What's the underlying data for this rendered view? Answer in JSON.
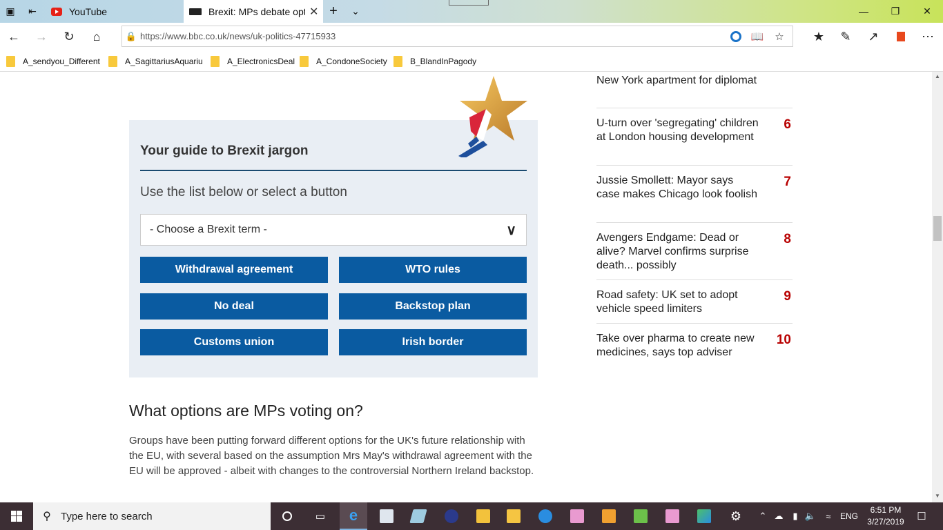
{
  "browser": {
    "tabs": [
      {
        "title": "YouTube",
        "favicon": "youtube-icon"
      },
      {
        "title": "Brexit: MPs debate opti",
        "favicon": "bbc-icon"
      }
    ],
    "url": "https://www.bbc.co.uk/news/uk-politics-47715933",
    "favorites": [
      {
        "label": "A_sendyou_Differentl"
      },
      {
        "label": "A_SagittariusAquariu:"
      },
      {
        "label": "A_ElectronicsDeal"
      },
      {
        "label": "A_CondoneSociety"
      },
      {
        "label": "B_BlandInPagody"
      }
    ]
  },
  "guide": {
    "title": "Your guide to Brexit jargon",
    "subtitle": "Use the list below or select a button",
    "select_value": "- Choose a Brexit term -",
    "buttons": [
      {
        "label": "Withdrawal agreement"
      },
      {
        "label": "WTO rules"
      },
      {
        "label": "No deal"
      },
      {
        "label": "Backstop plan"
      },
      {
        "label": "Customs union"
      },
      {
        "label": "Irish border"
      }
    ]
  },
  "article": {
    "heading": "What options are MPs voting on?",
    "paragraph": "Groups have been putting forward different options for the UK's future relationship with the EU, with several based on the assumption Mrs May's withdrawal agreement with the EU will be approved - albeit with changes to the controversial Northern Ireland backstop."
  },
  "most_read": [
    {
      "text": "New York apartment for diplomat",
      "num": ""
    },
    {
      "text": "U-turn over 'segregating' children at London housing development",
      "num": "6"
    },
    {
      "text": "Jussie Smollett: Mayor says case makes Chicago look foolish",
      "num": "7"
    },
    {
      "text": "Avengers Endgame: Dead or alive? Marvel confirms surprise death... possibly",
      "num": "8"
    },
    {
      "text": "Road safety: UK set to adopt vehicle speed limiters",
      "num": "9"
    },
    {
      "text": "Take over pharma to create new medicines, says top adviser",
      "num": "10"
    }
  ],
  "taskbar": {
    "search_placeholder": "Type here to search",
    "language": "ENG",
    "time": "6:51 PM",
    "date": "3/27/2019"
  },
  "colors": {
    "bbc_blue": "#0a5ba1",
    "most_read_red": "#b80000",
    "guide_bg": "#e9eef4",
    "taskbar": "#3c2e34"
  }
}
